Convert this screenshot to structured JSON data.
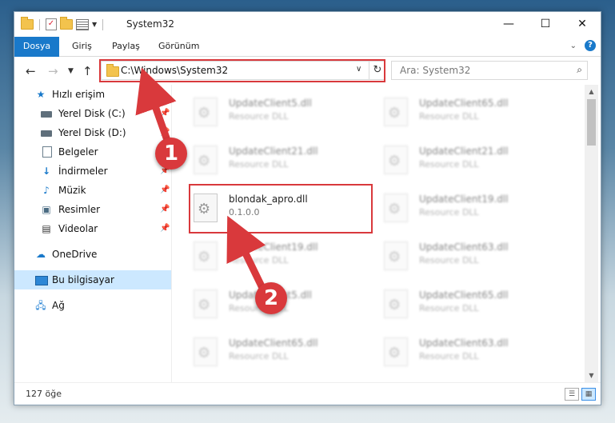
{
  "window": {
    "title": "System32"
  },
  "ribbon": {
    "tabs": [
      "Dosya",
      "Giriş",
      "Paylaş",
      "Görünüm"
    ]
  },
  "address": {
    "path": "C:\\Windows\\System32"
  },
  "search": {
    "placeholder": "Ara: System32"
  },
  "sidebar": {
    "items": [
      {
        "label": "Hızlı erişim",
        "icon": "star-icon"
      },
      {
        "label": "Yerel Disk (C:)",
        "icon": "drive-icon"
      },
      {
        "label": "Yerel Disk (D:)",
        "icon": "drive-icon"
      },
      {
        "label": "Belgeler",
        "icon": "document-icon"
      },
      {
        "label": "İndirmeler",
        "icon": "download-icon"
      },
      {
        "label": "Müzik",
        "icon": "music-icon"
      },
      {
        "label": "Resimler",
        "icon": "picture-icon"
      },
      {
        "label": "Videolar",
        "icon": "video-icon"
      },
      {
        "label": "OneDrive",
        "icon": "cloud-icon"
      },
      {
        "label": "Bu bilgisayar",
        "icon": "computer-icon"
      },
      {
        "label": "Ağ",
        "icon": "network-icon"
      }
    ]
  },
  "files": [
    {
      "name": "UpdateClient5.dll",
      "desc": "Resource DLL"
    },
    {
      "name": "UpdateClient65.dll",
      "desc": "Resource DLL"
    },
    {
      "name": "UpdateClient21.dll",
      "desc": "Resource DLL"
    },
    {
      "name": "UpdateClient21.dll",
      "desc": "Resource DLL"
    },
    {
      "name": "blondak_apro.dll",
      "desc": "0.1.0.0"
    },
    {
      "name": "UpdateClient19.dll",
      "desc": "Resource DLL"
    },
    {
      "name": "UpdateClient19.dll",
      "desc": "Resource DLL"
    },
    {
      "name": "UpdateClient63.dll",
      "desc": "Resource DLL"
    },
    {
      "name": "UpdateClient5.dll",
      "desc": "Resource DLL"
    },
    {
      "name": "UpdateClient65.dll",
      "desc": "Resource DLL"
    },
    {
      "name": "UpdateClient65.dll",
      "desc": "Resource DLL"
    },
    {
      "name": "UpdateClient63.dll",
      "desc": "Resource DLL"
    }
  ],
  "status": {
    "count": "127 öğe"
  },
  "annotations": {
    "step1": "1",
    "step2": "2"
  },
  "colors": {
    "accent": "#1979ca",
    "highlight": "#d9393c",
    "selected": "#cce8ff"
  }
}
